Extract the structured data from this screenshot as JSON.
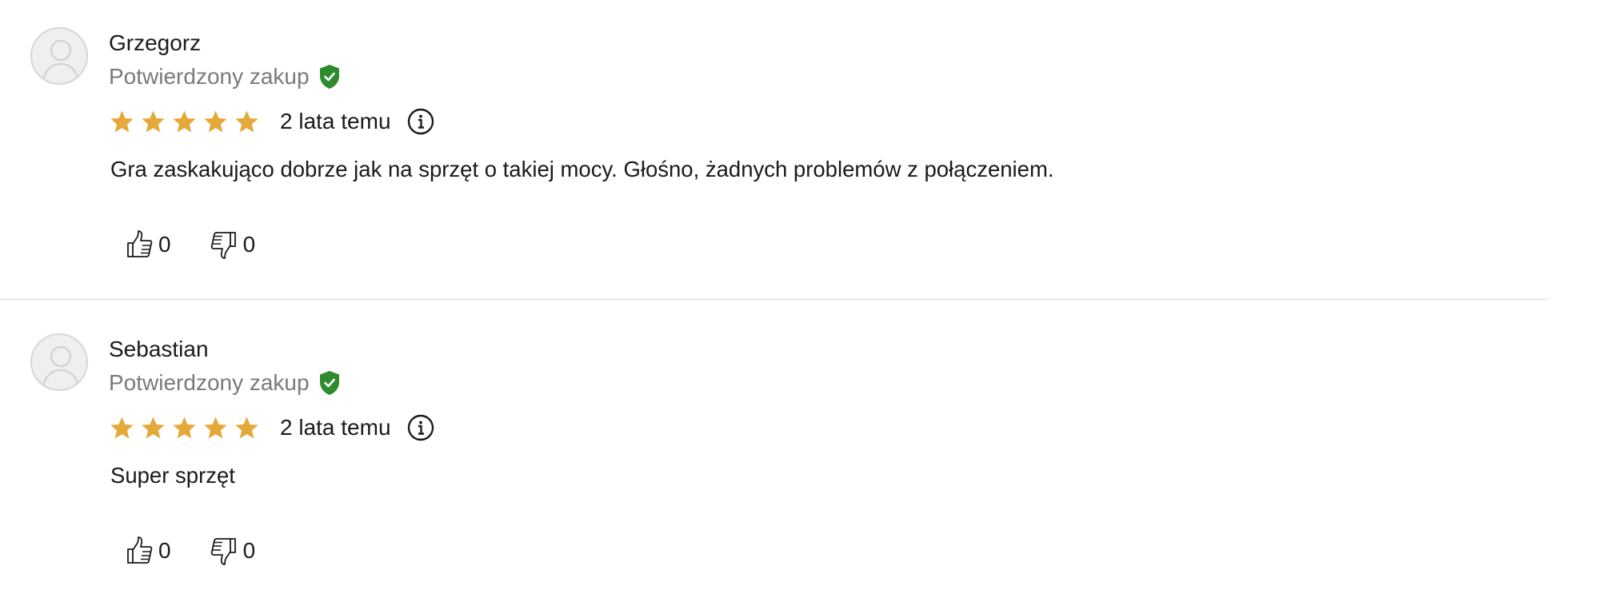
{
  "colors": {
    "star": "#E4A93A",
    "verified_shield": "#2E8B2E",
    "muted_text": "#7a7a7a",
    "divider": "#dcdcdc"
  },
  "reviews": [
    {
      "author": "Grzegorz",
      "verified_label": "Potwierdzony zakup",
      "rating": 5,
      "rating_max": 5,
      "date": "2 lata temu",
      "text": "Gra zaskakująco dobrze jak na sprzęt o takiej mocy. Głośno, żadnych problemów z połączeniem.",
      "likes": "0",
      "dislikes": "0"
    },
    {
      "author": "Sebastian",
      "verified_label": "Potwierdzony zakup",
      "rating": 5,
      "rating_max": 5,
      "date": "2 lata temu",
      "text": "Super sprzęt",
      "likes": "0",
      "dislikes": "0"
    }
  ],
  "icons": {
    "avatar": "user-avatar-icon",
    "verified": "shield-check-icon",
    "star": "star-icon",
    "info": "info-icon",
    "like": "thumbs-up-icon",
    "dislike": "thumbs-down-icon"
  }
}
